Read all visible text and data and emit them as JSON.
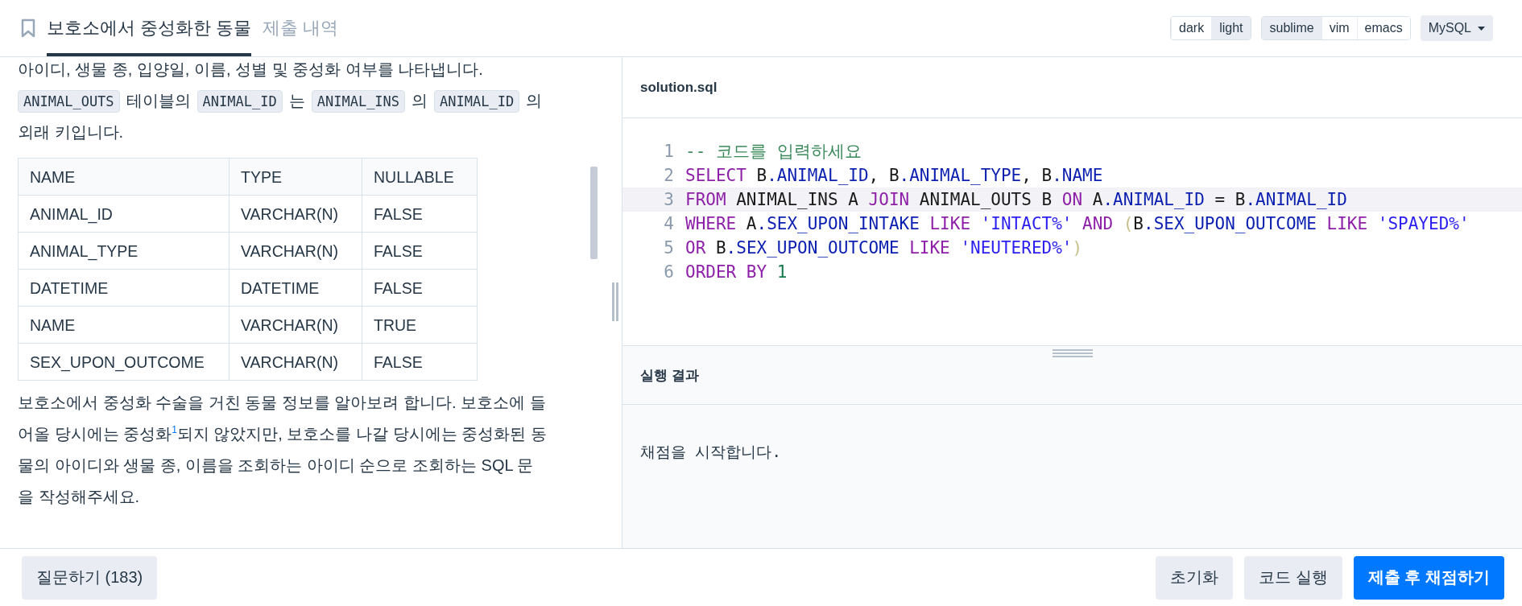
{
  "header": {
    "tabs": [
      {
        "label": "보호소에서 중성화한 동물",
        "selected": true
      },
      {
        "label": "제출 내역",
        "selected": false
      }
    ],
    "theme_options": [
      {
        "label": "dark",
        "selected": false
      },
      {
        "label": "light",
        "selected": true
      }
    ],
    "keymap_options": [
      {
        "label": "sublime",
        "selected": true
      },
      {
        "label": "vim",
        "selected": false
      },
      {
        "label": "emacs",
        "selected": false
      }
    ],
    "language": "MySQL"
  },
  "description": {
    "intro": "아이디, 생물 종, 입양일, 이름, 성별 및 중성화 여부를 나타냅니다.",
    "key_note": [
      {
        "kind": "code",
        "text": "ANIMAL_OUTS"
      },
      {
        "kind": "text",
        "text": "테이블의"
      },
      {
        "kind": "code",
        "text": "ANIMAL_ID"
      },
      {
        "kind": "text",
        "text": "는"
      },
      {
        "kind": "code",
        "text": "ANIMAL_INS"
      },
      {
        "kind": "text",
        "text": "의"
      },
      {
        "kind": "code",
        "text": "ANIMAL_ID"
      },
      {
        "kind": "text",
        "text": "의"
      },
      {
        "kind": "text",
        "text": "외래 키입니다."
      }
    ],
    "table": {
      "columns": [
        "NAME",
        "TYPE",
        "NULLABLE"
      ],
      "rows": [
        [
          "ANIMAL_ID",
          "VARCHAR(N)",
          "FALSE"
        ],
        [
          "ANIMAL_TYPE",
          "VARCHAR(N)",
          "FALSE"
        ],
        [
          "DATETIME",
          "DATETIME",
          "FALSE"
        ],
        [
          "NAME",
          "VARCHAR(N)",
          "TRUE"
        ],
        [
          "SEX_UPON_OUTCOME",
          "VARCHAR(N)",
          "FALSE"
        ]
      ]
    },
    "question": "보호소에서 중성화 수술을 거친 동물 정보를 알아보려 합니다. 보호소에 들어올 당시에는 중성화$^{1}$되지 않았지만, 보호소를 나갈 당시에는 중성화된 동물의 아이디와 생물 종, 이름을 조회하는 아이디 순으로 조회하는 SQL 문을 작성해주세요."
  },
  "editor": {
    "filename": "solution.sql",
    "lines": [
      {
        "number": "1",
        "active": false,
        "tokens": [
          {
            "kind": "comment",
            "text": "-- 코드를 입력하세요"
          }
        ]
      },
      {
        "number": "2",
        "active": false,
        "tokens": [
          {
            "kind": "keyword",
            "text": "SELECT"
          },
          {
            "kind": "plain",
            "text": " B"
          },
          {
            "kind": "property",
            "text": ".ANIMAL_ID"
          },
          {
            "kind": "plain",
            "text": ", B"
          },
          {
            "kind": "property",
            "text": ".ANIMAL_TYPE"
          },
          {
            "kind": "plain",
            "text": ", B"
          },
          {
            "kind": "property",
            "text": ".NAME"
          }
        ]
      },
      {
        "number": "3",
        "active": true,
        "tokens": [
          {
            "kind": "keyword",
            "text": "FROM"
          },
          {
            "kind": "plain",
            "text": " ANIMAL_INS A "
          },
          {
            "kind": "keyword",
            "text": "JOIN"
          },
          {
            "kind": "plain",
            "text": " ANIMAL_OUTS B "
          },
          {
            "kind": "keyword",
            "text": "ON"
          },
          {
            "kind": "plain",
            "text": " A"
          },
          {
            "kind": "property",
            "text": ".ANIMAL_ID"
          },
          {
            "kind": "plain",
            "text": " = B"
          },
          {
            "kind": "property",
            "text": ".ANIMAL_ID"
          }
        ]
      },
      {
        "number": "4",
        "active": false,
        "tokens": [
          {
            "kind": "keyword",
            "text": "WHERE"
          },
          {
            "kind": "plain",
            "text": " A"
          },
          {
            "kind": "property",
            "text": ".SEX_UPON_INTAKE"
          },
          {
            "kind": "keyword",
            "text": " LIKE"
          },
          {
            "kind": "string",
            "text": " 'INTACT%'"
          },
          {
            "kind": "keyword",
            "text": " AND"
          },
          {
            "kind": "bracket",
            "text": " ("
          },
          {
            "kind": "plain",
            "text": "B"
          },
          {
            "kind": "property",
            "text": ".SEX_UPON_OUTCOME"
          },
          {
            "kind": "keyword",
            "text": " LIKE"
          },
          {
            "kind": "string",
            "text": " 'SPAYED%'"
          }
        ]
      },
      {
        "number": "5",
        "active": false,
        "tokens": [
          {
            "kind": "keyword",
            "text": "OR"
          },
          {
            "kind": "plain",
            "text": " B"
          },
          {
            "kind": "property",
            "text": ".SEX_UPON_OUTCOME"
          },
          {
            "kind": "keyword",
            "text": " LIKE"
          },
          {
            "kind": "string",
            "text": " 'NEUTERED%'"
          },
          {
            "kind": "bracket",
            "text": ")"
          }
        ]
      },
      {
        "number": "6",
        "active": false,
        "tokens": [
          {
            "kind": "keyword",
            "text": "ORDER BY"
          },
          {
            "kind": "number",
            "text": " 1"
          }
        ]
      }
    ]
  },
  "result": {
    "title": "실행 결과",
    "output": "채점을 시작합니다."
  },
  "footer": {
    "ask_button": "질문하기 (183)",
    "actions": [
      {
        "kind": "secondary",
        "label": "초기화"
      },
      {
        "kind": "secondary",
        "label": "코드 실행"
      },
      {
        "kind": "primary",
        "label": "제출 후 채점하기"
      }
    ]
  }
}
